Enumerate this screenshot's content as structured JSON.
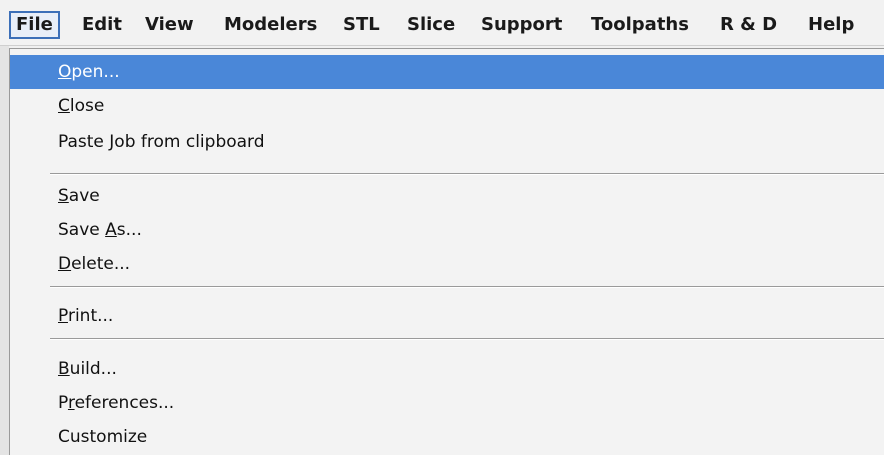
{
  "menubar": {
    "items": [
      {
        "label": "File"
      },
      {
        "label": "Edit"
      },
      {
        "label": "View"
      },
      {
        "label": "Modelers"
      },
      {
        "label": "STL"
      },
      {
        "label": "Slice"
      },
      {
        "label": "Support"
      },
      {
        "label": "Toolpaths"
      },
      {
        "label": "R & D"
      },
      {
        "label": "Help"
      }
    ]
  },
  "file_menu": {
    "open": {
      "mnemonic": "O",
      "rest": "pen..."
    },
    "close": {
      "mnemonic": "C",
      "rest": "lose"
    },
    "paste_job": {
      "label": "Paste Job from clipboard"
    },
    "save": {
      "mnemonic": "S",
      "rest": "ave"
    },
    "save_as": {
      "before": "Save ",
      "mnemonic": "A",
      "rest": "s..."
    },
    "delete": {
      "mnemonic": "D",
      "rest": "elete..."
    },
    "print": {
      "mnemonic": "P",
      "rest": "rint..."
    },
    "build": {
      "mnemonic": "B",
      "rest": "uild..."
    },
    "preferences": {
      "before": "P",
      "mnemonic": "r",
      "rest": "eferences..."
    },
    "customize": {
      "label": "Customize"
    }
  },
  "colors": {
    "highlight": "#4a87d8",
    "menu_background": "#f3f3f3",
    "open_menu_border": "#3c6fb8"
  }
}
